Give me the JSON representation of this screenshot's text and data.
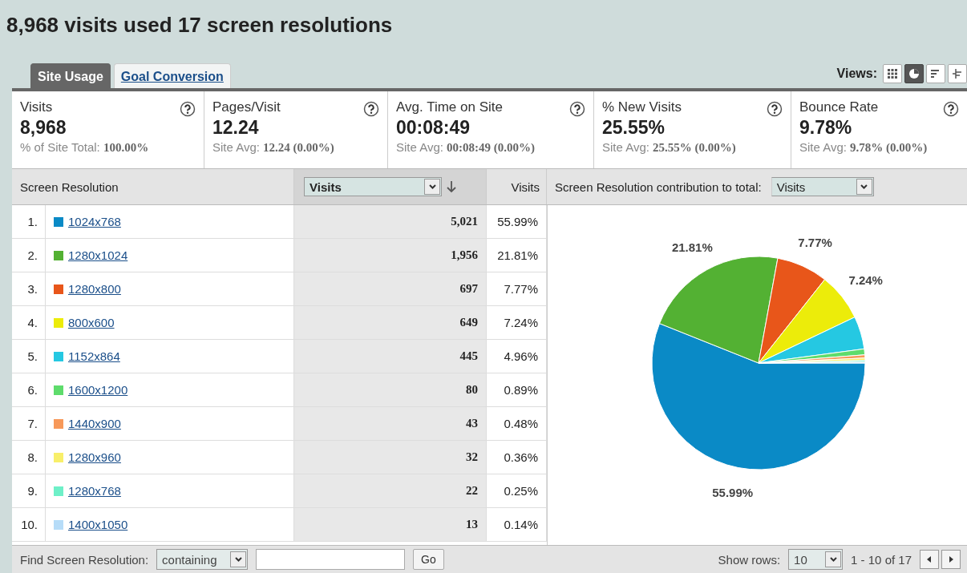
{
  "title": "8,968 visits used 17 screen resolutions",
  "tabs": [
    {
      "label": "Site Usage",
      "selected": true
    },
    {
      "label": "Goal Conversion",
      "selected": false
    }
  ],
  "views": {
    "label": "Views:",
    "buttons": [
      {
        "kind": "table",
        "selected": false
      },
      {
        "kind": "pie",
        "selected": true
      },
      {
        "kind": "bar",
        "selected": false
      },
      {
        "kind": "pivot",
        "selected": false
      }
    ]
  },
  "metrics": [
    {
      "label": "Visits",
      "value": "8,968",
      "note": "% of Site Total: **100.00%**"
    },
    {
      "label": "Pages/Visit",
      "value": "12.24",
      "note": "Site Avg: **12.24 (0.00%)**"
    },
    {
      "label": "Avg. Time on Site",
      "value": "00:08:49",
      "note": "Site Avg: **00:08:49 (0.00%)**"
    },
    {
      "label": "% New Visits",
      "value": "25.55%",
      "note": "Site Avg: **25.55% (0.00%)**"
    },
    {
      "label": "Bounce Rate",
      "value": "9.78%",
      "note": "Site Avg: **9.78% (0.00%)**"
    }
  ],
  "table": {
    "dimension_header": "Screen Resolution",
    "metric_select": "Visits",
    "percent_header": "Visits",
    "chart_header": "Screen Resolution contribution to total:",
    "chart_select": "Visits",
    "rows": [
      {
        "rank": "1.",
        "resolution": "1024x768",
        "color": "#0a8ac6",
        "visits": "5,021",
        "percent": "55.99%"
      },
      {
        "rank": "2.",
        "resolution": "1280x1024",
        "color": "#53b133",
        "visits": "1,956",
        "percent": "21.81%"
      },
      {
        "rank": "3.",
        "resolution": "1280x800",
        "color": "#e8561a",
        "visits": "697",
        "percent": "7.77%"
      },
      {
        "rank": "4.",
        "resolution": "800x600",
        "color": "#ecec0a",
        "visits": "649",
        "percent": "7.24%"
      },
      {
        "rank": "5.",
        "resolution": "1152x864",
        "color": "#25c8e2",
        "visits": "445",
        "percent": "4.96%"
      },
      {
        "rank": "6.",
        "resolution": "1600x1200",
        "color": "#5edc6c",
        "visits": "80",
        "percent": "0.89%"
      },
      {
        "rank": "7.",
        "resolution": "1440x900",
        "color": "#f7995a",
        "visits": "43",
        "percent": "0.48%"
      },
      {
        "rank": "8.",
        "resolution": "1280x960",
        "color": "#f8ef6a",
        "visits": "32",
        "percent": "0.36%"
      },
      {
        "rank": "9.",
        "resolution": "1280x768",
        "color": "#6ef0c8",
        "visits": "22",
        "percent": "0.25%"
      },
      {
        "rank": "10.",
        "resolution": "1400x1050",
        "color": "#b6dcf8",
        "visits": "13",
        "percent": "0.14%"
      }
    ],
    "chart_data": {
      "type": "pie",
      "values": [
        55.99,
        21.81,
        7.77,
        7.24,
        4.96,
        0.89,
        0.48,
        0.36,
        0.25,
        0.14
      ],
      "value_labels": [
        "55.99%",
        "21.81%",
        "7.77%",
        "7.24%",
        null,
        null,
        null,
        null,
        null,
        null
      ]
    }
  },
  "footer": {
    "find_label": "Find Screen Resolution:",
    "match_select": "containing",
    "go": "Go",
    "rows_label": "Show rows:",
    "rows_select": "10",
    "range": "1 - 10 of 17"
  }
}
